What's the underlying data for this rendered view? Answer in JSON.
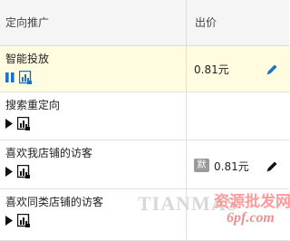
{
  "table": {
    "col_targeting": "定向推广",
    "col_bid": "出价",
    "rows": [
      {
        "name": "智能投放",
        "state": "running",
        "price": "0.81元",
        "has_edit": true,
        "badge": ""
      },
      {
        "name": "搜索重定向",
        "state": "paused",
        "price": "",
        "has_edit": false,
        "badge": ""
      },
      {
        "name": "喜欢我店铺的访客",
        "state": "paused",
        "price": "0.81元",
        "has_edit": true,
        "badge": "默"
      },
      {
        "name": "喜欢同类店铺的访客",
        "state": "paused",
        "price": "",
        "has_edit": false,
        "badge": ""
      }
    ]
  },
  "watermark": {
    "latin": "TIANMAS",
    "cn": "资源批发网",
    "url": "6pf.com"
  },
  "colors": {
    "highlight_row": "#fffce0",
    "running_icon": "#1a73c9",
    "edit_icon": "#1a73c9",
    "badge_bg": "#9a9a9a"
  }
}
